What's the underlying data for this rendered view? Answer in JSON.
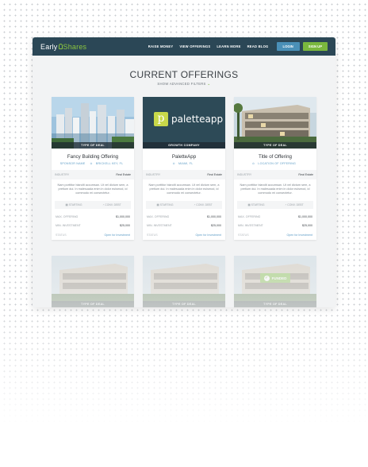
{
  "nav": {
    "logo_main": "Early",
    "logo_accent": "Shares",
    "links": [
      "RAISE MONEY",
      "VIEW OFFERINGS",
      "LEARN MORE",
      "READ BLOG"
    ],
    "login": "LOGIN",
    "signup": "SIGN UP"
  },
  "page": {
    "heading": "CURRENT OFFERINGS",
    "filters": "SHOW ADVANCED FILTERS"
  },
  "cards": [
    {
      "tag": "TYPE OF DEAL",
      "title": "Fancy Building Offering",
      "sub1": "SPONSOR NAME",
      "sub2": "BRICKELL KEY, FL",
      "industry_label": "INDUSTRY",
      "industry_value": "Real Estate",
      "desc": "Nam porttitor blandit accumsan. Ut vel dictum sem, a pretium dui. In malesuada enim in dolor euismod, id commodo mi consectetur.",
      "meta1": "STARTING",
      "meta2": "CONV. DEBT",
      "kv1_label": "MAX. OFFERING",
      "kv1_value": "$1,000,000",
      "kv2_label": "MIN. INVESTMENT",
      "kv2_value": "$25,000",
      "foot_label": "STATUS",
      "foot_value": "Open for Investment"
    },
    {
      "tag": "GROWTH COMPANY",
      "title": "PaletteApp",
      "sub1": "MIAMI, FL",
      "logo_letter": "p",
      "logo_text": "paletteapp",
      "industry_label": "INDUSTRY",
      "industry_value": "Real Estate",
      "desc": "Nam porttitor blandit accumsan. Ut vel dictum sem, a pretium dui. In malesuada enim in dolor euismod, id commodo mi consectetur.",
      "meta1": "STARTING",
      "meta2": "CONV. DEBT",
      "kv1_label": "MAX. OFFERING",
      "kv1_value": "$1,000,000",
      "kv2_label": "MIN. INVESTMENT",
      "kv2_value": "$25,000",
      "foot_label": "STATUS",
      "foot_value": "Open for Investment"
    },
    {
      "tag": "TYPE OF DEAL",
      "title": "Title of Offering",
      "sub1": "LOCATION OF OFFERING",
      "industry_label": "INDUSTRY",
      "industry_value": "Real Estate",
      "desc": "Nam porttitor blandit accumsan. Ut vel dictum sem, a pretium dui. In malesuada enim in dolor euismod, id commodo mi consectetur.",
      "meta1": "STARTING",
      "meta2": "CONV. DEBT",
      "kv1_label": "MAX. OFFERING",
      "kv1_value": "$1,000,000",
      "kv2_label": "MIN. INVESTMENT",
      "kv2_value": "$25,000",
      "foot_label": "STATUS",
      "foot_value": "Open for Investment"
    }
  ],
  "row2": [
    {
      "tag": "TYPE OF DEAL"
    },
    {
      "tag": "TYPE OF DEAL"
    },
    {
      "tag": "TYPE OF DEAL",
      "badge": "FUNDED"
    }
  ],
  "colors": {
    "nav": "#2b4756",
    "accent_green": "#7ab83e",
    "accent_blue": "#4a90b8",
    "link_blue": "#5d9cc6"
  }
}
